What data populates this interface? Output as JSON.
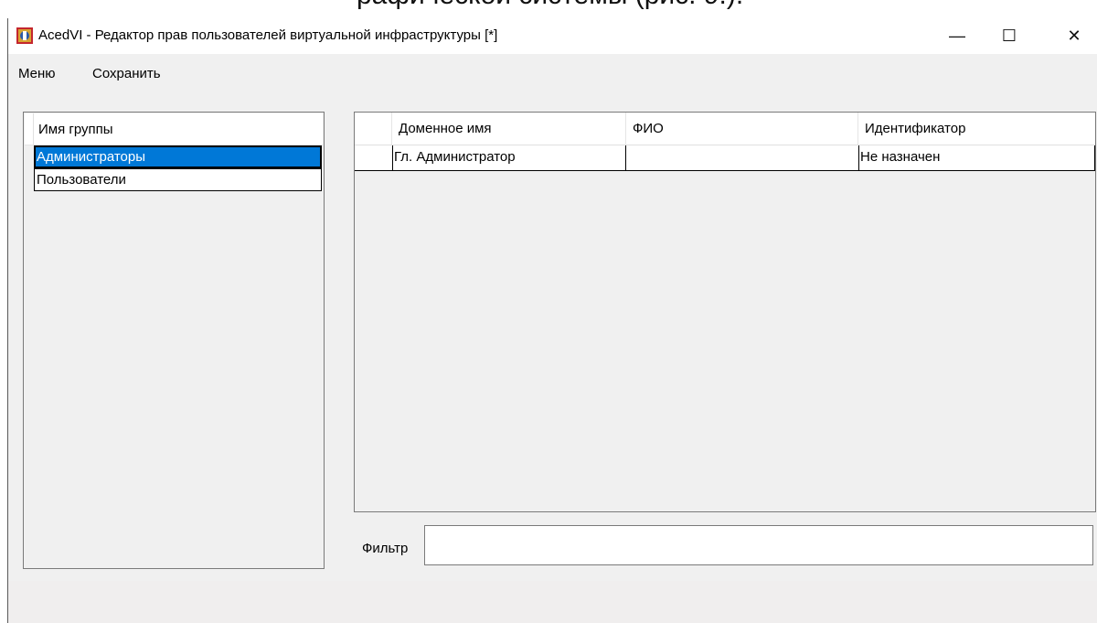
{
  "top_fragment": "рафической системы (рис. 9.).",
  "window": {
    "title": "AcedVI - Редактор прав пользователей виртуальной инфраструктуры [*]",
    "app_icon": "app-shield-icon",
    "controls": {
      "minimize": "—",
      "maximize": "☐",
      "close": "✕"
    }
  },
  "menu": {
    "items": [
      {
        "label": "Меню"
      },
      {
        "label": "Сохранить"
      }
    ]
  },
  "groups": {
    "header": "Имя группы",
    "rows": [
      {
        "label": "Администраторы",
        "selected": true
      },
      {
        "label": "Пользователи",
        "selected": false
      }
    ]
  },
  "users_table": {
    "columns": [
      "Доменное имя",
      "ФИО",
      "Идентификатор"
    ],
    "rows": [
      {
        "domain_name": "Гл. Администратор",
        "full_name": "",
        "identifier": "Не назначен"
      }
    ]
  },
  "filter": {
    "label": "Фильтр",
    "value": ""
  },
  "colors": {
    "selection": "#0078d7",
    "window_bg": "#f0f0f0"
  }
}
